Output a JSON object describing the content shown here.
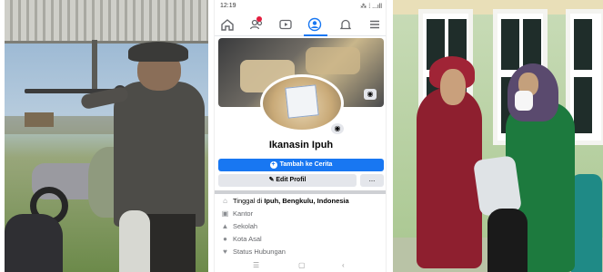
{
  "phone": {
    "status": {
      "time": "12:19",
      "icons": "⁂ ⁞ ...ıll"
    },
    "profile_name": "Ikanasin Ipuh",
    "add_story_label": "Tambah ke Cerita",
    "edit_profile_label": "Edit Profil",
    "more_label": "...",
    "info": {
      "lives_prefix": "Tinggal di ",
      "lives_place": "Ipuh, Bengkulu, Indonesia",
      "work": "Kantor",
      "school": "Sekolah",
      "hometown": "Kota Asal",
      "relationship": "Status Hubungan"
    },
    "nav_icons": [
      "home-icon",
      "friends-icon",
      "video-icon",
      "profile-icon",
      "notifications-icon",
      "menu-icon"
    ],
    "accent_color": "#1877f2"
  }
}
